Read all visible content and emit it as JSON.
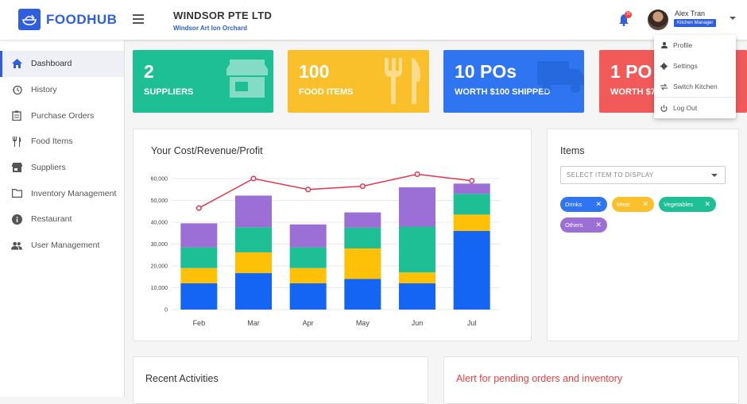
{
  "header": {
    "brand": "FOODHUB",
    "company": "WINDSOR PTE LTD",
    "location": "Windsor Art Ion Orchard",
    "notification_count": "10",
    "user_name": "Alex Tran",
    "user_role": "Kitchen Manager"
  },
  "sidebar": {
    "items": [
      {
        "label": "Dashboard",
        "icon": "home-icon",
        "active": true
      },
      {
        "label": "History",
        "icon": "history-icon"
      },
      {
        "label": "Purchase Orders",
        "icon": "clipboard-icon"
      },
      {
        "label": "Food Items",
        "icon": "utensils-icon"
      },
      {
        "label": "Suppliers",
        "icon": "store-icon"
      },
      {
        "label": "Inventory Management",
        "icon": "folder-icon"
      },
      {
        "label": "Restaurant",
        "icon": "info-icon"
      },
      {
        "label": "User Management",
        "icon": "people-icon"
      }
    ]
  },
  "stats": [
    {
      "value": "2",
      "label": "SUPPLIERS",
      "color": "#1fbf96"
    },
    {
      "value": "100",
      "label": "FOOD ITEMS",
      "color": "#f9c02c"
    },
    {
      "value": "10 POs",
      "label": "WORTH $100 SHIPPED",
      "color": "#2f74f0"
    },
    {
      "value": "1 PO",
      "label": "WORTH $7",
      "color": "#f25a5a"
    }
  ],
  "chart_panel": {
    "title": "Your Cost/Revenue/Profit"
  },
  "items_panel": {
    "title": "Items",
    "select_placeholder": "SELECT ITEM TO DISPLAY",
    "chips": [
      {
        "label": "Drinks",
        "color": "#2f74f0"
      },
      {
        "label": "Meat",
        "color": "#f9c02c"
      },
      {
        "label": "Vegetables",
        "color": "#1fbf96"
      },
      {
        "label": "Others",
        "color": "#9b6fd6"
      }
    ]
  },
  "recent_panel": {
    "title": "Recent Activities"
  },
  "alert_panel": {
    "title": "Alert for pending orders and inventory",
    "color": "#f04040"
  },
  "user_menu": {
    "items": [
      {
        "label": "Profile",
        "icon": "person-icon"
      },
      {
        "label": "Settings",
        "icon": "gear-icon"
      },
      {
        "label": "Switch Kitchen",
        "icon": "swap-icon"
      },
      {
        "label": "Log Out",
        "icon": "power-icon"
      }
    ]
  },
  "chart_data": {
    "type": "bar",
    "stacked": true,
    "categories": [
      "Feb",
      "Mar",
      "Apr",
      "May",
      "Jun",
      "Jul"
    ],
    "y_ticks": [
      "0",
      "10,000",
      "20,000",
      "30,000",
      "40,000",
      "50,000",
      "60,000"
    ],
    "ylim": [
      0,
      60000
    ],
    "series": [
      {
        "color": "#1565f5",
        "values": [
          12000,
          16700,
          12000,
          14000,
          12000,
          36000
        ]
      },
      {
        "color": "#ffc107",
        "values": [
          7000,
          9500,
          7000,
          14000,
          5000,
          7500
        ]
      },
      {
        "color": "#1fbf96",
        "values": [
          9500,
          11500,
          9500,
          9500,
          21000,
          9500
        ]
      },
      {
        "color": "#9b6fd6",
        "values": [
          11000,
          14500,
          10500,
          7000,
          18000,
          4700
        ]
      }
    ],
    "line": {
      "color": "#e8334a",
      "values": [
        46500,
        60000,
        55000,
        56500,
        62000,
        59000
      ]
    }
  }
}
